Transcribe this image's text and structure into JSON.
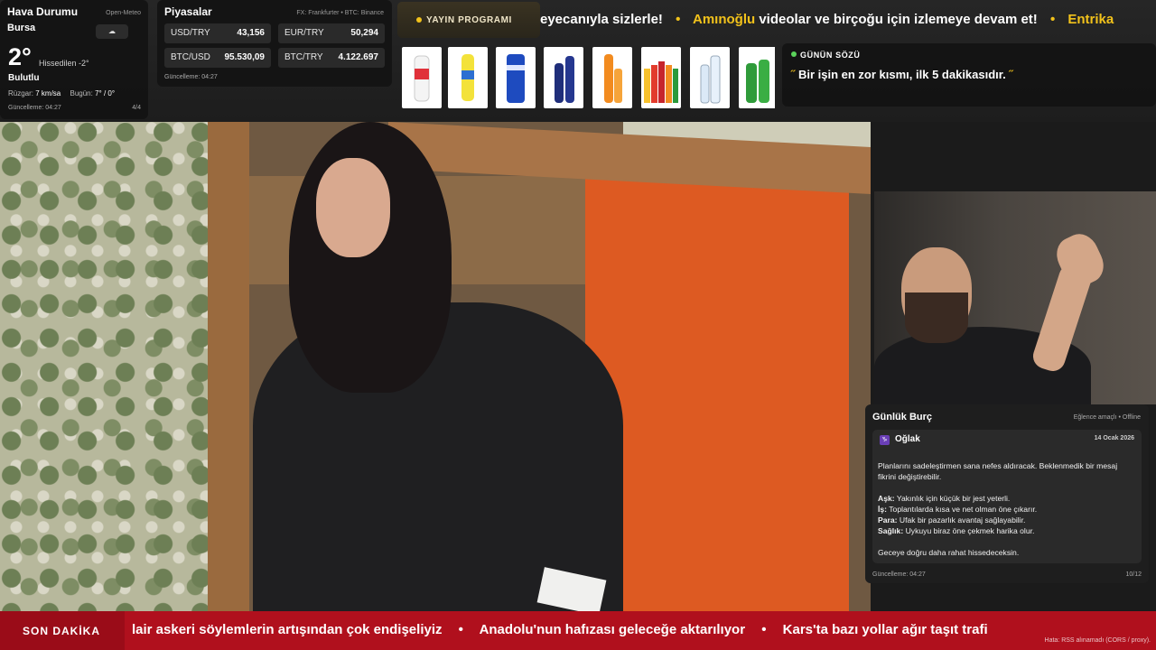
{
  "weather": {
    "title": "Hava Durumu",
    "source": "Open-Meteo",
    "city": "Bursa",
    "condition_icon": "cloud-icon",
    "temperature": "2°",
    "feels_like": "Hissedilen -2°",
    "description": "Bulutlu",
    "wind_label": "Rüzgar:",
    "wind_value": "7 km/sa",
    "today_label": "Bugün:",
    "today_value": "7° / 0°",
    "updated": "Güncelleme: 04:27",
    "page": "4/4"
  },
  "markets": {
    "title": "Piyasalar",
    "source": "FX: Frankfurter • BTC: Binance",
    "items": [
      {
        "key": "USD/TRY",
        "value": "43,156"
      },
      {
        "key": "EUR/TRY",
        "value": "50,294"
      },
      {
        "key": "BTC/USD",
        "value": "95.530,09"
      },
      {
        "key": "BTC/TRY",
        "value": "4.122.697"
      }
    ],
    "updated": "Güncelleme: 04:27"
  },
  "program_button": {
    "label": "YAYIN PROGRAMI"
  },
  "top_ticker": {
    "segments": [
      {
        "text": "eyecanıyla sizlerle!",
        "highlight": false
      },
      {
        "text": "Amınoğlu",
        "highlight": true
      },
      {
        "text": " videolar ve birçoğu için izlemeye devam et!",
        "highlight": false
      },
      {
        "text": "Entrika",
        "highlight": true
      }
    ]
  },
  "quote": {
    "heading": "GÜNÜN SÖZÜ",
    "open_mark": "˝",
    "text": "Bir işin en zor kısmı, ilk 5 dakikasıdır.",
    "close_mark": "˝"
  },
  "products": [
    "white",
    "yellow",
    "blue",
    "navy",
    "orange",
    "multi",
    "clear",
    "green"
  ],
  "horoscope": {
    "title": "Günlük Burç",
    "mode": "Eğlence amaçlı • Offline",
    "sign_symbol": "♑",
    "sign": "Oğlak",
    "date": "14 Ocak 2026",
    "intro": "Planlarını sadeleştirmen sana nefes aldıracak. Beklenmedik bir mesaj fikrini değiştirebilir.",
    "lines": [
      {
        "label": "Aşk:",
        "text": "Yakınlık için küçük bir jest yeterli."
      },
      {
        "label": "İş:",
        "text": "Toplantılarda kısa ve net olman öne çıkarır."
      },
      {
        "label": "Para:",
        "text": "Ufak bir pazarlık avantaj sağlayabilir."
      },
      {
        "label": "Sağlık:",
        "text": "Uykuyu biraz öne çekmek harika olur."
      }
    ],
    "outro": "Geceye doğru daha rahat hissedeceksin.",
    "updated": "Güncelleme: 04:27",
    "page": "10/12"
  },
  "breaking": {
    "badge": "SON DAKİKA",
    "items": [
      "lair askeri söylemlerin artışından çok endişeliyiz",
      "Anadolu'nun hafızası geleceğe aktarılıyor",
      "Kars'ta bazı yollar ağır taşıt trafi"
    ],
    "error_note": "Hata: RSS alınamadı (CORS / proxy)."
  },
  "colors": {
    "accent_yellow": "#f2c21b",
    "breaking_red": "#b0101d",
    "live_green": "#5bd35b"
  }
}
